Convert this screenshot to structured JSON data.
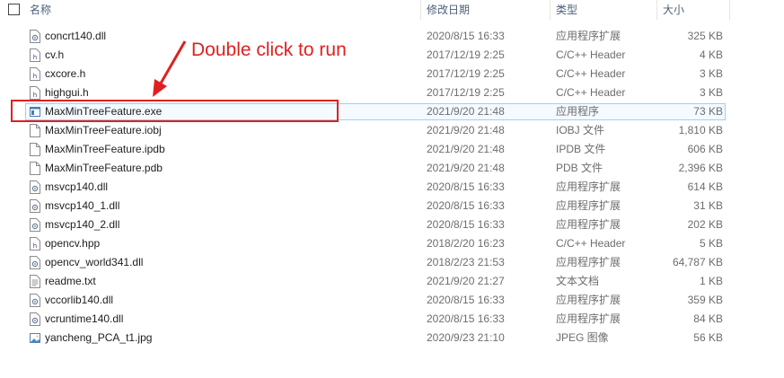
{
  "columns": {
    "name": "名称",
    "date": "修改日期",
    "type": "类型",
    "size": "大小"
  },
  "annotation": "Double click to run",
  "files": [
    {
      "name": "concrt140.dll",
      "date": "2020/8/15 16:33",
      "type": "应用程序扩展",
      "size": "325 KB",
      "icon": "dll-icon"
    },
    {
      "name": "cv.h",
      "date": "2017/12/19 2:25",
      "type": "C/C++ Header",
      "size": "4 KB",
      "icon": "header-file-icon"
    },
    {
      "name": "cxcore.h",
      "date": "2017/12/19 2:25",
      "type": "C/C++ Header",
      "size": "3 KB",
      "icon": "header-file-icon"
    },
    {
      "name": "highgui.h",
      "date": "2017/12/19 2:25",
      "type": "C/C++ Header",
      "size": "3 KB",
      "icon": "header-file-icon"
    },
    {
      "name": "MaxMinTreeFeature.exe",
      "date": "2021/9/20 21:48",
      "type": "应用程序",
      "size": "73 KB",
      "icon": "exe-icon",
      "selected": true
    },
    {
      "name": "MaxMinTreeFeature.iobj",
      "date": "2021/9/20 21:48",
      "type": "IOBJ 文件",
      "size": "1,810 KB",
      "icon": "file-icon"
    },
    {
      "name": "MaxMinTreeFeature.ipdb",
      "date": "2021/9/20 21:48",
      "type": "IPDB 文件",
      "size": "606 KB",
      "icon": "file-icon"
    },
    {
      "name": "MaxMinTreeFeature.pdb",
      "date": "2021/9/20 21:48",
      "type": "PDB 文件",
      "size": "2,396 KB",
      "icon": "file-icon"
    },
    {
      "name": "msvcp140.dll",
      "date": "2020/8/15 16:33",
      "type": "应用程序扩展",
      "size": "614 KB",
      "icon": "dll-icon"
    },
    {
      "name": "msvcp140_1.dll",
      "date": "2020/8/15 16:33",
      "type": "应用程序扩展",
      "size": "31 KB",
      "icon": "dll-icon"
    },
    {
      "name": "msvcp140_2.dll",
      "date": "2020/8/15 16:33",
      "type": "应用程序扩展",
      "size": "202 KB",
      "icon": "dll-icon"
    },
    {
      "name": "opencv.hpp",
      "date": "2018/2/20 16:23",
      "type": "C/C++ Header",
      "size": "5 KB",
      "icon": "header-file-icon"
    },
    {
      "name": "opencv_world341.dll",
      "date": "2018/2/23 21:53",
      "type": "应用程序扩展",
      "size": "64,787 KB",
      "icon": "dll-icon"
    },
    {
      "name": "readme.txt",
      "date": "2021/9/20 21:27",
      "type": "文本文档",
      "size": "1 KB",
      "icon": "text-file-icon"
    },
    {
      "name": "vccorlib140.dll",
      "date": "2020/8/15 16:33",
      "type": "应用程序扩展",
      "size": "359 KB",
      "icon": "dll-icon"
    },
    {
      "name": "vcruntime140.dll",
      "date": "2020/8/15 16:33",
      "type": "应用程序扩展",
      "size": "84 KB",
      "icon": "dll-icon"
    },
    {
      "name": "yancheng_PCA_t1.jpg",
      "date": "2020/9/23 21:10",
      "type": "JPEG 图像",
      "size": "56 KB",
      "icon": "image-file-icon"
    }
  ]
}
